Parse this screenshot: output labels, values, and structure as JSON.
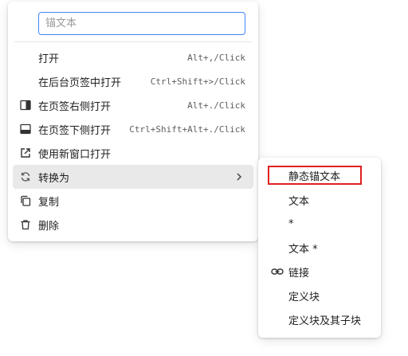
{
  "search": {
    "placeholder": "锚文本"
  },
  "main_menu": {
    "items": [
      {
        "label": "打开",
        "shortcut": "Alt+,/Click",
        "icon": ""
      },
      {
        "label": "在后台页签中打开",
        "shortcut": "Ctrl+Shift+>/Click",
        "icon": ""
      },
      {
        "label": "在页签右侧打开",
        "shortcut": "Alt+./Click",
        "icon": "split-right-icon"
      },
      {
        "label": "在页签下侧打开",
        "shortcut": "Ctrl+Shift+Alt+./Click",
        "icon": "split-bottom-icon"
      },
      {
        "label": "使用新窗口打开",
        "shortcut": "",
        "icon": "open-external-icon"
      },
      {
        "label": "转换为",
        "shortcut": "",
        "icon": "refresh-icon",
        "has_submenu": true,
        "active": true
      },
      {
        "label": "复制",
        "shortcut": "",
        "icon": "copy-icon"
      },
      {
        "label": "删除",
        "shortcut": "",
        "icon": "trash-icon"
      }
    ]
  },
  "sub_menu": {
    "items": [
      {
        "label": "静态锚文本",
        "highlighted": true
      },
      {
        "label": "文本"
      },
      {
        "label": "*"
      },
      {
        "label": "文本 *"
      },
      {
        "label": "链接",
        "icon": "link-icon"
      },
      {
        "label": "定义块"
      },
      {
        "label": "定义块及其子块"
      }
    ]
  },
  "colors": {
    "focus_border": "#4285f4",
    "highlight_border": "#e02020",
    "active_bg": "#e9e9e9"
  }
}
